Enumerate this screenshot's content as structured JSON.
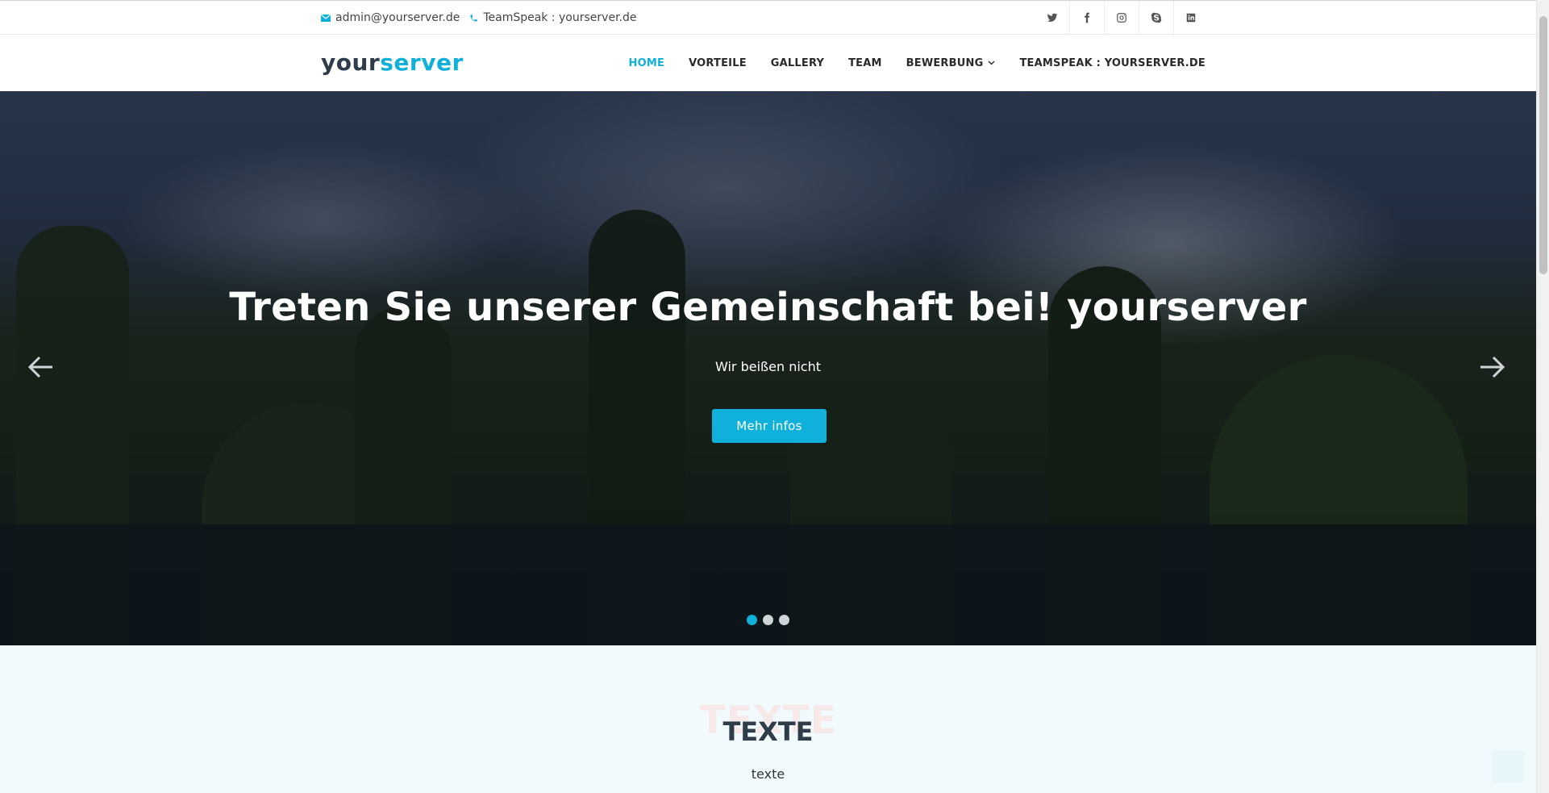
{
  "topbar": {
    "email": "admin@yourserver.de",
    "teamspeak": "TeamSpeak : yourserver.de",
    "social": [
      "twitter-icon",
      "facebook-icon",
      "instagram-icon",
      "skype-icon",
      "linkedin-icon"
    ]
  },
  "header": {
    "logo_part1": "your",
    "logo_part2": "server",
    "nav": [
      {
        "label": "HOME",
        "active": true
      },
      {
        "label": "VORTEILE"
      },
      {
        "label": "GALLERY"
      },
      {
        "label": "TEAM"
      },
      {
        "label": "BEWERBUNG"
      },
      {
        "label": "TEAMSPEAK : YOURSERVER.DE"
      }
    ]
  },
  "hero": {
    "title": "Treten Sie unserer Gemeinschaft bei! yourserver",
    "subtitle": "Wir beißen nicht",
    "button": "Mehr infos",
    "slides": 3,
    "active_slide": 1
  },
  "section": {
    "bg_title": "TEXTE",
    "title": "TEXTE",
    "text": "texte"
  },
  "colors": {
    "accent": "#0fb0d9",
    "dark": "#2f3d4a"
  }
}
